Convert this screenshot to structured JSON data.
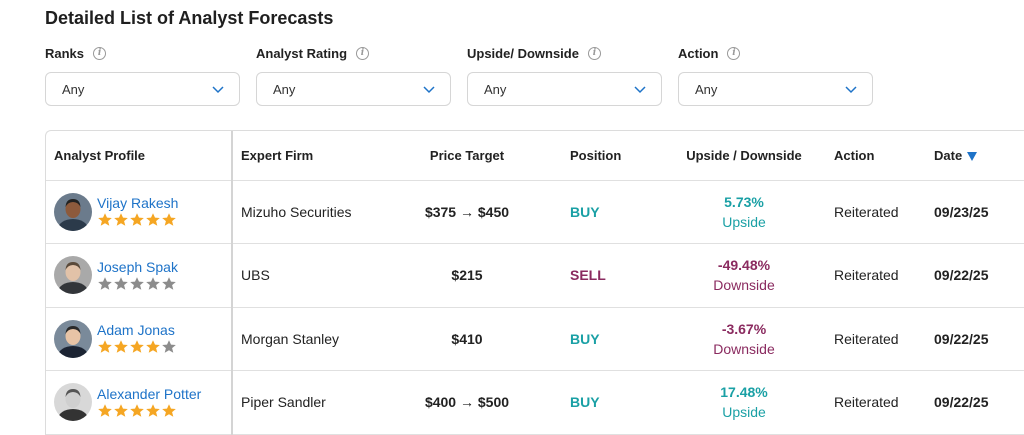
{
  "page": {
    "title": "Detailed List of Analyst Forecasts"
  },
  "filters": [
    {
      "label": "Ranks",
      "value": "Any"
    },
    {
      "label": "Analyst Rating",
      "value": "Any"
    },
    {
      "label": "Upside/ Downside",
      "value": "Any"
    },
    {
      "label": "Action",
      "value": "Any"
    }
  ],
  "table": {
    "headers": {
      "profile": "Analyst Profile",
      "firm": "Expert Firm",
      "target": "Price Target",
      "position": "Position",
      "upside": "Upside / Downside",
      "action": "Action",
      "date": "Date"
    },
    "rows": [
      {
        "name": "Vijay Rakesh",
        "stars": 5,
        "firm": "Mizuho Securities",
        "target": "$375 → $450",
        "position": "BUY",
        "pct": "5.73%",
        "direction": "Upside",
        "action": "Reiterated",
        "date": "09/23/25"
      },
      {
        "name": "Joseph Spak",
        "stars": 0,
        "firm": "UBS",
        "target": "$215",
        "position": "SELL",
        "pct": "-49.48%",
        "direction": "Downside",
        "action": "Reiterated",
        "date": "09/22/25"
      },
      {
        "name": "Adam Jonas",
        "stars": 4,
        "firm": "Morgan Stanley",
        "target": "$410",
        "position": "BUY",
        "pct": "-3.67%",
        "direction": "Downside",
        "action": "Reiterated",
        "date": "09/22/25"
      },
      {
        "name": "Alexander Potter",
        "stars": 5,
        "firm": "Piper Sandler",
        "target": "$400 → $500",
        "position": "BUY",
        "pct": "17.48%",
        "direction": "Upside",
        "action": "Reiterated",
        "date": "09/22/25"
      }
    ]
  },
  "colors": {
    "link": "#1e73c8",
    "buy": "#1aa0a5",
    "sell": "#8a2a5f",
    "star_on": "#f5a623",
    "star_off": "#8c8c8c"
  }
}
